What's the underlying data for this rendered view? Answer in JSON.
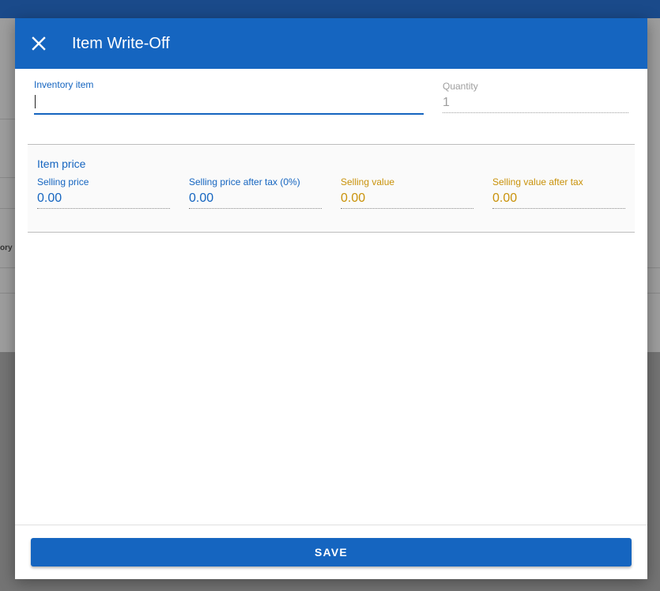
{
  "background": {
    "partial_text": "ory it"
  },
  "dialog": {
    "title": "Item Write-Off",
    "close_icon": "close-icon",
    "inventory_item": {
      "label": "Inventory item",
      "value": ""
    },
    "quantity": {
      "label": "Quantity",
      "value": "1"
    },
    "item_price": {
      "title": "Item price",
      "fields": [
        {
          "label": "Selling price",
          "value": "0.00",
          "color": "#1565c0"
        },
        {
          "label": "Selling price after tax (0%)",
          "value": "0.00",
          "color": "#1565c0"
        },
        {
          "label": "Selling value",
          "value": "0.00",
          "color": "#c9920a"
        },
        {
          "label": "Selling value after tax",
          "value": "0.00",
          "color": "#c9920a"
        }
      ]
    },
    "save_label": "SAVE"
  },
  "colors": {
    "primary": "#1565c0",
    "accent_gold": "#c9920a",
    "disabled": "#9e9e9e"
  }
}
